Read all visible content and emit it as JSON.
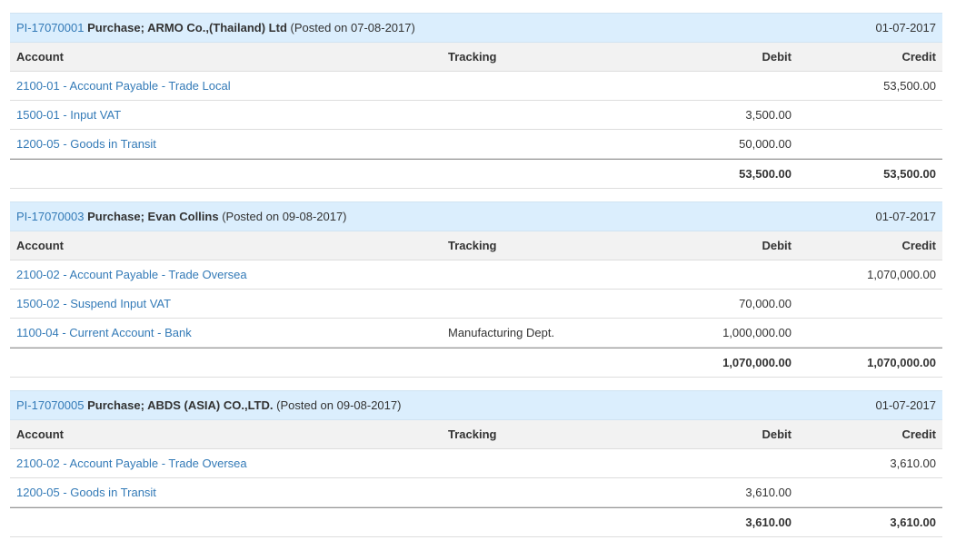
{
  "columns": {
    "account": "Account",
    "tracking": "Tracking",
    "debit": "Debit",
    "credit": "Credit"
  },
  "journals": [
    {
      "ref": "PI-17070001",
      "title": "Purchase; ARMO Co.,(Thailand) Ltd",
      "posted": "(Posted on 07-08-2017)",
      "date": "01-07-2017",
      "lines": [
        {
          "account": "2100-01 - Account Payable - Trade Local",
          "tracking": "",
          "debit": "",
          "credit": "53,500.00"
        },
        {
          "account": "1500-01 - Input VAT",
          "tracking": "",
          "debit": "3,500.00",
          "credit": ""
        },
        {
          "account": "1200-05 - Goods in Transit",
          "tracking": "",
          "debit": "50,000.00",
          "credit": ""
        }
      ],
      "total_debit": "53,500.00",
      "total_credit": "53,500.00"
    },
    {
      "ref": "PI-17070003",
      "title": "Purchase; Evan Collins",
      "posted": "(Posted on 09-08-2017)",
      "date": "01-07-2017",
      "lines": [
        {
          "account": "2100-02 - Account Payable - Trade Oversea",
          "tracking": "",
          "debit": "",
          "credit": "1,070,000.00"
        },
        {
          "account": "1500-02 - Suspend Input VAT",
          "tracking": "",
          "debit": "70,000.00",
          "credit": ""
        },
        {
          "account": "1100-04 - Current Account - Bank",
          "tracking": "Manufacturing Dept.",
          "debit": "1,000,000.00",
          "credit": ""
        }
      ],
      "total_debit": "1,070,000.00",
      "total_credit": "1,070,000.00"
    },
    {
      "ref": "PI-17070005",
      "title": "Purchase; ABDS (ASIA) CO.,LTD.",
      "posted": "(Posted on 09-08-2017)",
      "date": "01-07-2017",
      "lines": [
        {
          "account": "2100-02 - Account Payable - Trade Oversea",
          "tracking": "",
          "debit": "",
          "credit": "3,610.00"
        },
        {
          "account": "1200-05 - Goods in Transit",
          "tracking": "",
          "debit": "3,610.00",
          "credit": ""
        }
      ],
      "total_debit": "3,610.00",
      "total_credit": "3,610.00"
    }
  ],
  "colors": {
    "link": "#337ab7",
    "header_bg": "#dbeefd",
    "column_bg": "#f2f2f2"
  }
}
